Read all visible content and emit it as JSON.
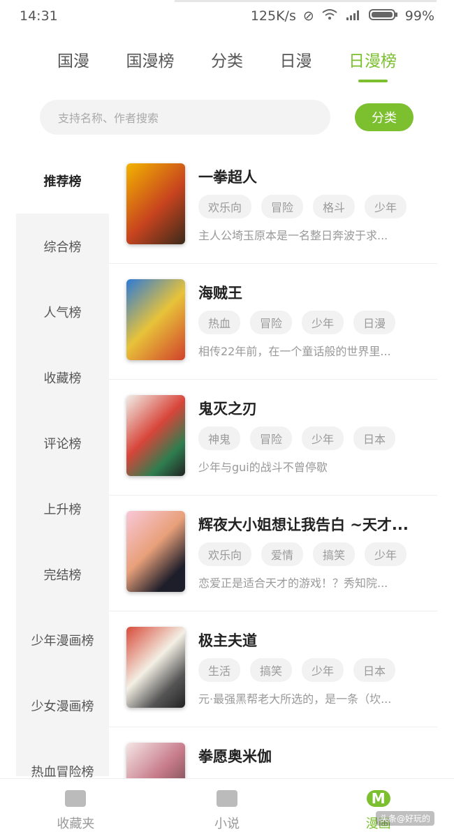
{
  "status": {
    "time": "14:31",
    "network": "125K/s",
    "battery": "99%"
  },
  "tabs": [
    "国漫",
    "国漫榜",
    "分类",
    "日漫",
    "日漫榜"
  ],
  "active_tab": 4,
  "search": {
    "placeholder": "支持名称、作者搜索"
  },
  "category_button": "分类",
  "sidebar": [
    "推荐榜",
    "综合榜",
    "人气榜",
    "收藏榜",
    "评论榜",
    "上升榜",
    "完结榜",
    "少年漫画榜",
    "少女漫画榜",
    "热血冒险榜"
  ],
  "items": [
    {
      "title": "一拳超人",
      "tags": [
        "欢乐向",
        "冒险",
        "格斗",
        "少年"
      ],
      "desc": "主人公埼玉原本是一名整日奔波于求..."
    },
    {
      "title": "海贼王",
      "tags": [
        "热血",
        "冒险",
        "少年",
        "日漫"
      ],
      "desc": "相传22年前，在一个童话般的世界里..."
    },
    {
      "title": "鬼灭之刃",
      "tags": [
        "神鬼",
        "冒险",
        "少年",
        "日本"
      ],
      "desc": "少年与gui的战斗不曾停歇"
    },
    {
      "title": "辉夜大小姐想让我告白 ~天才...",
      "tags": [
        "欢乐向",
        "爱情",
        "搞笑",
        "少年"
      ],
      "desc": "恋爱正是适合天才的游戏！？秀知院..."
    },
    {
      "title": "极主夫道",
      "tags": [
        "生活",
        "搞笑",
        "少年",
        "日本"
      ],
      "desc": "元·最强黑帮老大所选的，是一条（坎..."
    },
    {
      "title": "拳愿奥米伽",
      "tags": [
        "",
        "",
        "",
        ""
      ],
      "desc": ""
    }
  ],
  "bottom_nav": [
    "收藏夹",
    "小说",
    "漫画"
  ],
  "colors": {
    "accent": "#7cbf2f"
  },
  "watermark": "头条@好玩的"
}
